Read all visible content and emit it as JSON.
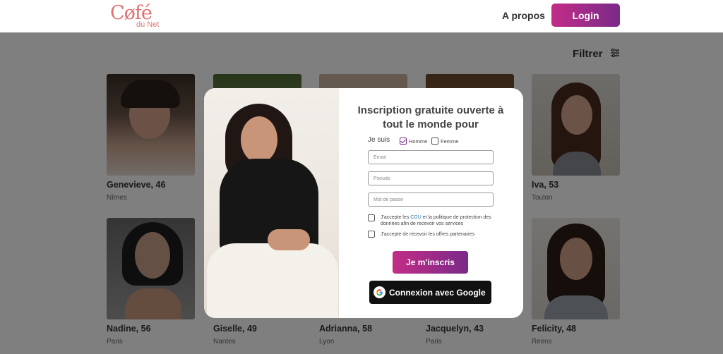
{
  "header": {
    "logo_text": "Cøfé",
    "logo_sub": "du Net",
    "nav_apropos": "A propos",
    "login_label": "Login"
  },
  "filter_label": "Filtrer",
  "profiles": [
    {
      "name": "Genevieve, 46",
      "city": "Nîmes"
    },
    {
      "name": "Iva, 53",
      "city": "Toulon"
    },
    {
      "name": "Nadine, 56",
      "city": "Paris"
    },
    {
      "name": "Giselle, 49",
      "city": "Nantes"
    },
    {
      "name": "Adrianna, 58",
      "city": "Lyon"
    },
    {
      "name": "Jacquelyn, 43",
      "city": "Paris"
    },
    {
      "name": "Felicity, 48",
      "city": "Reims"
    }
  ],
  "modal": {
    "title": "Inscription gratuite ouverte à tout le monde pour",
    "je_suis": "Je suis",
    "homme": "Homme",
    "femme": "Femme",
    "email_placeholder": "Email",
    "pseudo_placeholder": "Pseudo",
    "password_placeholder": "Mot de passe",
    "consent_prefix": "J'accepte les",
    "consent_cgu": "CGU",
    "consent_suffix": "et la politique de protection des données afin de recevoir vos services",
    "offers_label": "J'accepte de recevoir les offres partenaires",
    "signup_label": "Je m'inscris",
    "google_label": "Connexion avec Google"
  },
  "colors": {
    "brand_gradient_start": "#c22d87",
    "brand_gradient_end": "#7a2a88",
    "logo": "#e07272"
  }
}
